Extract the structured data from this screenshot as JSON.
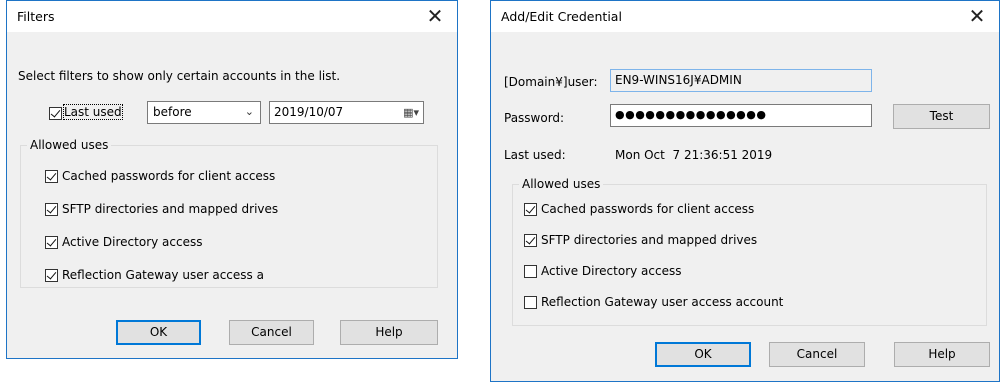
{
  "filters": {
    "title": "Filters",
    "close_glyph": "✕",
    "instruction": "Select filters to show only certain accounts in the list.",
    "last_used": {
      "checked": true,
      "label": "Last used",
      "comparison": "before",
      "date": "2019/10/07"
    },
    "allowed_uses": {
      "legend": "Allowed uses",
      "items": [
        {
          "label": "Cached passwords for client access",
          "checked": true
        },
        {
          "label": "SFTP directories and mapped drives",
          "checked": true
        },
        {
          "label": "Active Directory access",
          "checked": true
        },
        {
          "label": "Reflection Gateway user access a",
          "checked": true
        }
      ]
    },
    "buttons": {
      "ok": "OK",
      "cancel": "Cancel",
      "help": "Help"
    }
  },
  "credential": {
    "title": "Add/Edit Credential",
    "close_glyph": "✕",
    "user_label": "[Domain¥]user:",
    "user_value": "EN9-WINS16J¥ADMIN",
    "password_label": "Password:",
    "password_value": "●●●●●●●●●●●●●●●",
    "test_label": "Test",
    "last_used_label": "Last used:",
    "last_used_value": "Mon Oct  7 21:36:51 2019",
    "allowed_uses": {
      "legend": "Allowed uses",
      "items": [
        {
          "label": "Cached passwords for client access",
          "checked": true
        },
        {
          "label": "SFTP directories and mapped drives",
          "checked": true
        },
        {
          "label": "Active Directory access",
          "checked": false
        },
        {
          "label": "Reflection Gateway user access account",
          "checked": false
        }
      ]
    },
    "buttons": {
      "ok": "OK",
      "cancel": "Cancel",
      "help": "Help"
    }
  }
}
